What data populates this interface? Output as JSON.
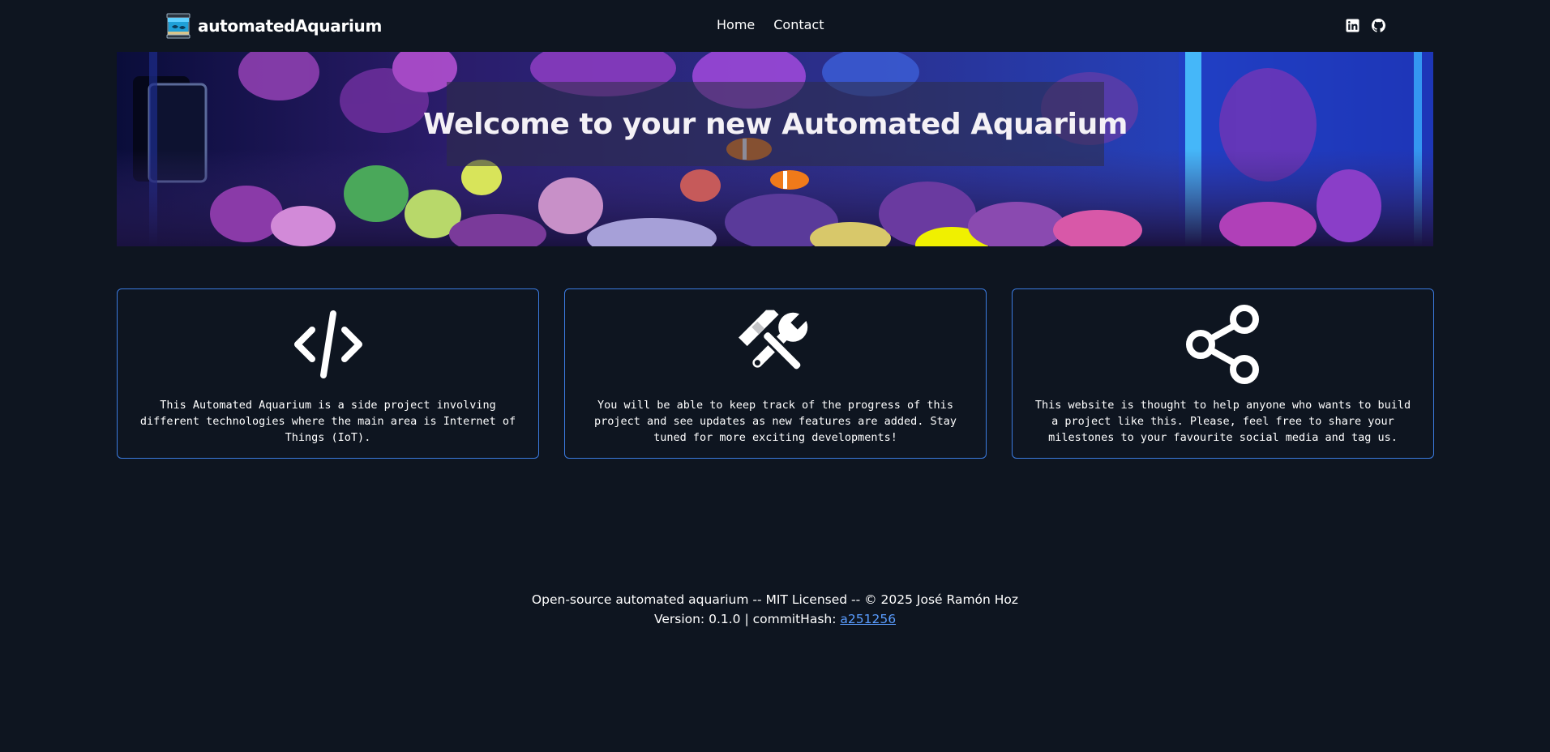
{
  "header": {
    "brand": "automatedAquarium",
    "brand_icon": "aquarium-logo-icon",
    "nav": [
      {
        "label": "Home"
      },
      {
        "label": "Contact"
      }
    ],
    "social": [
      {
        "icon": "linkedin-icon"
      },
      {
        "icon": "github-icon"
      }
    ]
  },
  "hero": {
    "title": "Welcome to your new Automated Aquarium"
  },
  "cards": [
    {
      "icon": "code-icon",
      "text": "This Automated Aquarium is a side project involving different technologies where the main area is Internet of Things (IoT)."
    },
    {
      "icon": "tools-icon",
      "text": "You will be able to keep track of the progress of this project and see updates as new features are added. Stay tuned for more exciting developments!"
    },
    {
      "icon": "share-icon",
      "text": "This website is thought to help anyone who wants to build a project like this. Please, feel free to share your milestones to your favourite social media and tag us."
    }
  ],
  "footer": {
    "line1": "Open-source automated aquarium -- MIT Licensed -- © 2025 José Ramón Hoz",
    "version_label": "Version: 0.1.0 | commitHash: ",
    "commit_hash": "a251256"
  },
  "colors": {
    "background": "#0e1520",
    "card_border": "#3b7be0",
    "link": "#5a9dff"
  }
}
